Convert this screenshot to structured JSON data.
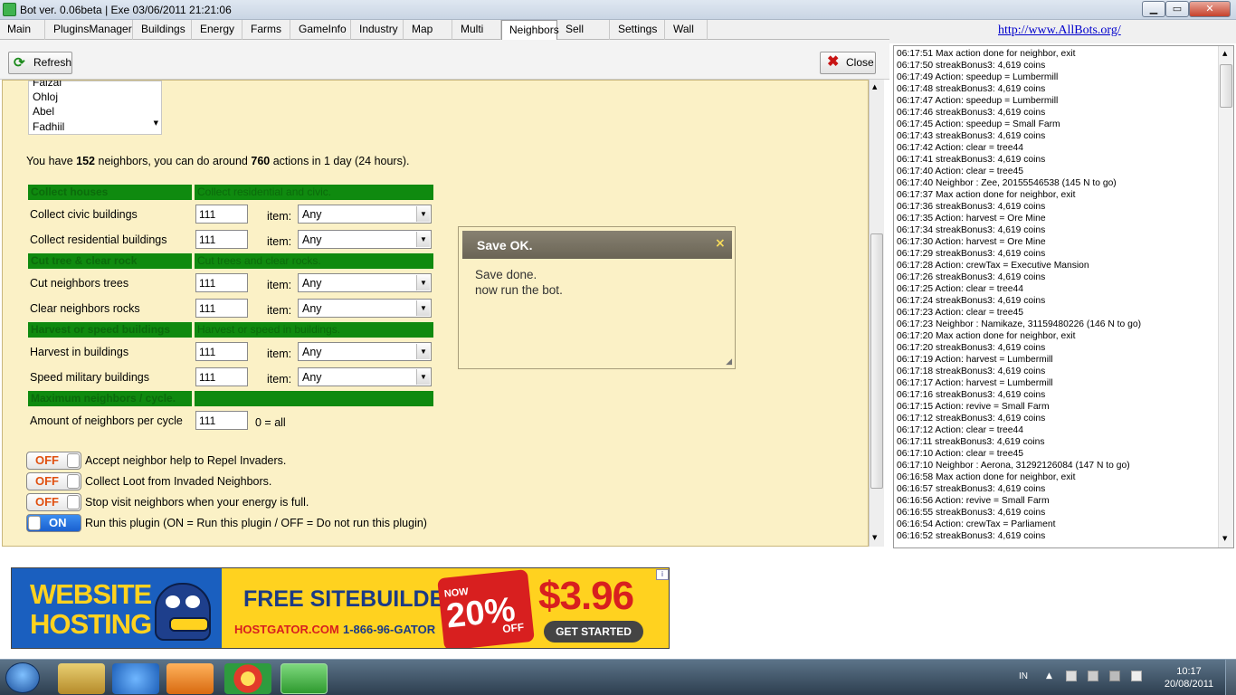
{
  "window": {
    "title": "Bot ver. 0.06beta | Exe 03/06/2011 21:21:06",
    "controls": {
      "minimize": "▁",
      "maximize": "▭",
      "close": "✕"
    }
  },
  "menu": {
    "tabs": [
      "Main",
      "PluginsManager",
      "Buildings",
      "Energy",
      "Farms",
      "GameInfo",
      "Industry",
      "Map",
      "Multi",
      "Neighbors",
      "Sell",
      "Settings",
      "Wall"
    ],
    "active": "Neighbors"
  },
  "toolbar": {
    "refresh_label": "Refresh",
    "close_label": "Close"
  },
  "neighbor_list": [
    "Faizal",
    "Ohloj",
    "Abel",
    "Fadhiil"
  ],
  "summary": {
    "prefix": "You have ",
    "neighbors": "152",
    "middle": " neighbors, you can do around ",
    "actions": "760",
    "suffix": " actions in 1 day (24 hours)."
  },
  "sections": [
    {
      "title": "Collect houses",
      "desc": "Collect residential and civic.",
      "rows": [
        {
          "label": "Collect civic buildings",
          "value": "111",
          "item_label": "item:",
          "item": "Any"
        },
        {
          "label": "Collect residential buildings",
          "value": "111",
          "item_label": "item:",
          "item": "Any"
        }
      ]
    },
    {
      "title": "Cut tree & clear rock",
      "desc": "Cut trees and clear rocks.",
      "rows": [
        {
          "label": "Cut neighbors trees",
          "value": "111",
          "item_label": "item:",
          "item": "Any"
        },
        {
          "label": "Clear neighbors rocks",
          "value": "111",
          "item_label": "item:",
          "item": "Any"
        }
      ]
    },
    {
      "title": "Harvest or speed buildings",
      "desc": "Harvest or speed in buildings.",
      "rows": [
        {
          "label": "Harvest in buildings",
          "value": "111",
          "item_label": "item:",
          "item": "Any"
        },
        {
          "label": "Speed military buildings",
          "value": "111",
          "item_label": "item:",
          "item": "Any"
        }
      ]
    },
    {
      "title": "Maximum neighbors / cycle.",
      "desc": "",
      "rows": [
        {
          "label": "Amount of neighbors per cycle",
          "value": "111",
          "hint": "0 = all"
        }
      ]
    }
  ],
  "toggles": [
    {
      "state": "OFF",
      "label": "Accept neighbor help to Repel Invaders."
    },
    {
      "state": "OFF",
      "label": "Collect Loot from Invaded Neighbors."
    },
    {
      "state": "OFF",
      "label": "Stop visit neighbors when your energy is full."
    },
    {
      "state": "ON",
      "label": "Run this plugin (ON = Run this plugin / OFF = Do not run this plugin)"
    }
  ],
  "dialog": {
    "title": "Save OK.",
    "close": "×",
    "lines": [
      "Save done.",
      "now run the bot."
    ]
  },
  "right_pane": {
    "link": "http://www.AllBots.org/",
    "log": [
      "06:17:51 Max action done for neighbor, exit",
      "06:17:50 streakBonus3: 4,619 coins",
      "06:17:49 Action: speedup = Lumbermill",
      "06:17:48 streakBonus3: 4,619 coins",
      "06:17:47 Action: speedup = Lumbermill",
      "06:17:46 streakBonus3: 4,619 coins",
      "06:17:45 Action: speedup = Small Farm",
      "06:17:43 streakBonus3: 4,619 coins",
      "06:17:42 Action: clear = tree44",
      "06:17:41 streakBonus3: 4,619 coins",
      "06:17:40 Action: clear = tree45",
      "06:17:40 Neighbor : Zee, 20155546538 (145 N to go)",
      "06:17:37 Max action done for neighbor, exit",
      "06:17:36 streakBonus3: 4,619 coins",
      "06:17:35 Action: harvest = Ore Mine",
      "06:17:34 streakBonus3: 4,619 coins",
      "06:17:30 Action: harvest = Ore Mine",
      "06:17:29 streakBonus3: 4,619 coins",
      "06:17:28 Action: crewTax = Executive Mansion",
      "06:17:26 streakBonus3: 4,619 coins",
      "06:17:25 Action: clear = tree44",
      "06:17:24 streakBonus3: 4,619 coins",
      "06:17:23 Action: clear = tree45",
      "06:17:23 Neighbor : Namikaze, 31159480226 (146 N to go)",
      "06:17:20 Max action done for neighbor, exit",
      "06:17:20 streakBonus3: 4,619 coins",
      "06:17:19 Action: harvest = Lumbermill",
      "06:17:18 streakBonus3: 4,619 coins",
      "06:17:17 Action: harvest = Lumbermill",
      "06:17:16 streakBonus3: 4,619 coins",
      "06:17:15 Action: revive = Small Farm",
      "06:17:12 streakBonus3: 4,619 coins",
      "06:17:12 Action: clear = tree44",
      "06:17:11 streakBonus3: 4,619 coins",
      "06:17:10 Action: clear = tree45",
      "06:17:10 Neighbor : Aerona, 31292126084 (147 N to go)",
      "06:16:58 Max action done for neighbor, exit",
      "06:16:57 streakBonus3: 4,619 coins",
      "06:16:56 Action: revive = Small Farm",
      "06:16:55 streakBonus3: 4,619 coins",
      "06:16:54 Action: crewTax = Parliament",
      "06:16:52 streakBonus3: 4,619 coins"
    ]
  },
  "ad": {
    "headline_1": "WEBSITE",
    "headline_2": "HOSTING",
    "product": "FREE SITEBUILDER",
    "domain": "HOSTGATOR.COM",
    "phone": "1-866-96-GATOR",
    "badge_top": "NOW",
    "badge_pct": "20%",
    "badge_off": "OFF",
    "price": "$3.96",
    "cta": "GET STARTED NOW",
    "colors": {
      "blue": "#1a5fbf",
      "yellow": "#ffd21f",
      "red": "#d81f1f"
    }
  },
  "taskbar": {
    "lang": "IN",
    "time": "10:17",
    "date": "20/08/2011"
  },
  "colors": {
    "panel": "#fbf1c6",
    "section": "#0f8a0f",
    "toggle_off": "#e05010",
    "toggle_on": "#1a60d0"
  }
}
